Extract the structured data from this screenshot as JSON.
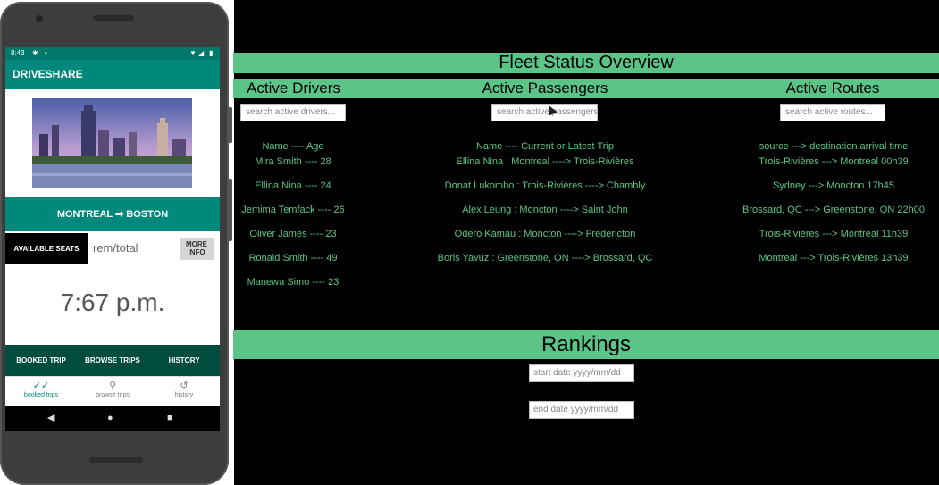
{
  "phone": {
    "status": {
      "time": "8:43"
    },
    "app_title": "DRIVESHARE",
    "route": "MONTREAL ➡ BOSTON",
    "available_seats_label": "AVAILABLE SEATS",
    "seats_placeholder": "rem/total",
    "more_info_line1": "MORE",
    "more_info_line2": "INFO",
    "time": "7:67 p.m.",
    "buttons": {
      "booked": "BOOKED TRIP",
      "browse": "BROWSE TRIPS",
      "history": "HISTORY"
    },
    "tabs": {
      "booked": "booked trips",
      "browse": "browse trips",
      "history": "history"
    }
  },
  "dashboard": {
    "title": "Fleet Status Overview",
    "drivers": {
      "header": "Active Drivers",
      "placeholder": "search active drivers...",
      "column": "Name ---- Age",
      "rows": [
        "Mira Smith ---- 28",
        "Ellina Nina ---- 24",
        "Jemima Temfack ---- 26",
        "Oliver James ---- 23",
        "Ronald Smith ---- 49",
        "Manewa Simo ---- 23"
      ]
    },
    "passengers": {
      "header": "Active Passengers",
      "placeholder": "search active passengers...",
      "column": "Name ---- Current or Latest Trip",
      "rows": [
        "Ellina Nina : Montreal ----> Trois-Rivières",
        "Donat Lukombo : Trois-Rivières ----> Chambly",
        "Alex Leung : Moncton ----> Saint John",
        "Odero Kamau : Moncton ----> Fredericton",
        "Boris Yavuz : Greenstone, ON ----> Brossard, QC"
      ]
    },
    "routes": {
      "header": "Active Routes",
      "placeholder": "search active routes...",
      "column": "source ---> destination arrival time",
      "rows": [
        "Trois-Rivières ---> Montreal 00h39",
        "Sydney ---> Moncton 17h45",
        "Brossard, QC ---> Greenstone, ON 22h00",
        "Trois-Rivières ---> Montreal 11h39",
        "Montreal ---> Trois-Rivières 13h39"
      ]
    },
    "rankings": {
      "title": "Rankings",
      "start_placeholder": "start date yyyy/mm/dd",
      "end_placeholder": "end date yyyy/mm/dd"
    }
  },
  "colors": {
    "accent": "#5ac587",
    "teal": "#00897b",
    "dark_teal": "#004d40"
  }
}
